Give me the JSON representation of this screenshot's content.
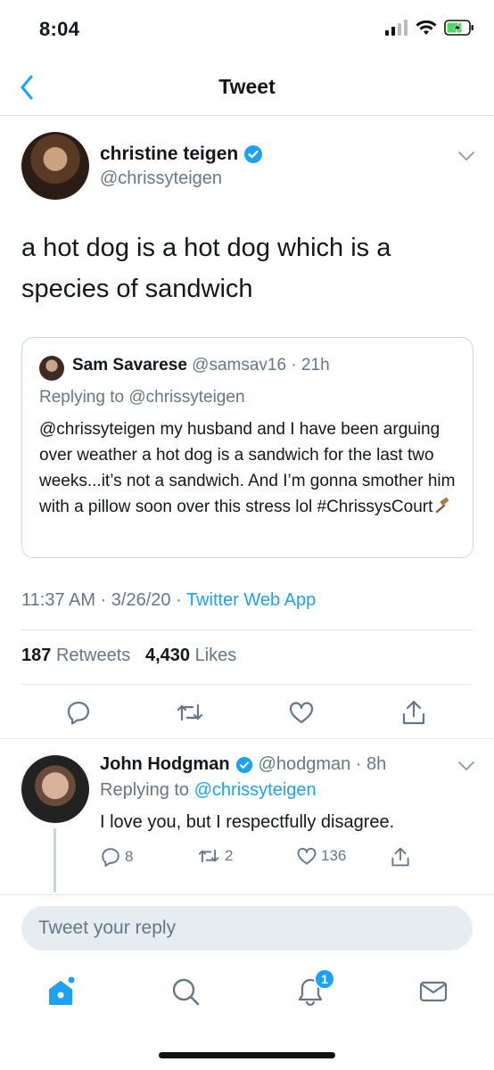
{
  "status_bar": {
    "time": "8:04",
    "icons": [
      "signal-icon",
      "wifi-icon",
      "battery-charging-icon"
    ]
  },
  "nav": {
    "title": "Tweet",
    "back_icon": "chevron-left-icon"
  },
  "tweet": {
    "author": {
      "name": "christine teigen",
      "handle": "@chrissyteigen",
      "verified": true
    },
    "text": "a hot dog is a hot dog which is a species of sandwich",
    "quote": {
      "name": "Sam Savarese",
      "handle_time": "@samsav16 · 21h",
      "replying_to": "Replying to @chrissyteigen",
      "text": "@chrissyteigen my husband and I have been arguing over weather a hot dog is a sandwich for the last two weeks...it’s not a sandwich. And I’m gonna smother him with a pillow soon over this stress lol  #ChrissysCourt"
    },
    "meta": {
      "timestamp": "11:37 AM · 3/26/20 · ",
      "source": "Twitter Web App"
    },
    "stats": {
      "retweets_count": "187",
      "retweets_label": "Retweets",
      "likes_count": "4,430",
      "likes_label": "Likes"
    }
  },
  "reply": {
    "name": "John Hodgman",
    "handle_time": "@hodgman · 8h",
    "verified": true,
    "replying_prefix": "Replying to ",
    "replying_handle": "@chrissyteigen",
    "text": "I love you, but I respectfully disagree.",
    "reply_count": "8",
    "retweet_count": "2",
    "like_count": "136"
  },
  "compose": {
    "placeholder": "Tweet your reply"
  },
  "tabbar": {
    "notification_badge": "1"
  },
  "colors": {
    "accent": "#1da1f2",
    "muted": "#657786",
    "border": "#e1e8ed"
  }
}
